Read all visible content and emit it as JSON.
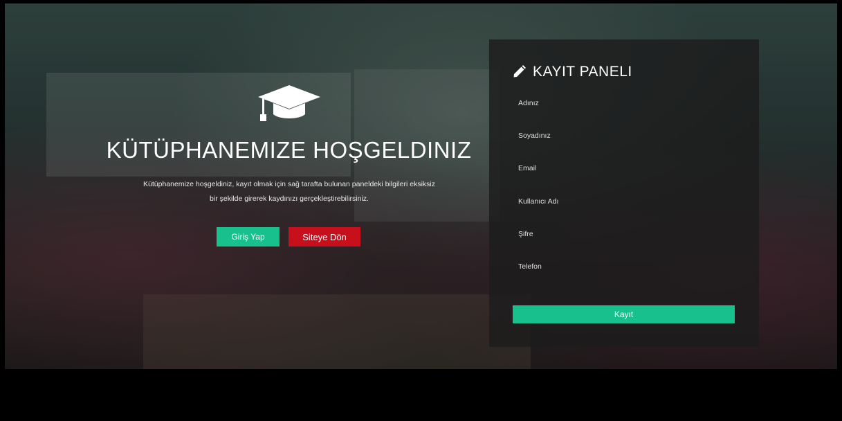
{
  "hero": {
    "title": "KÜTÜPHANEMIZE HOŞGELDINIZ",
    "text_line1": "Kütüphanemize hoşgeldiniz, kayıt olmak için sağ tarafta bulunan paneldeki bilgileri eksiksiz",
    "text_line2": "bir şekilde girerek kaydınızı gerçekleştirebilirsiniz.",
    "login_label": "Giriş Yap",
    "back_label": "Siteye Dön",
    "icon": "graduation-cap-icon"
  },
  "panel": {
    "title": "KAYIT PANELI",
    "icon": "pencil-icon",
    "fields": [
      {
        "label": "Adınız",
        "value": ""
      },
      {
        "label": "Soyadınız",
        "value": ""
      },
      {
        "label": "Email",
        "value": ""
      },
      {
        "label": "Kullanıcı Adı",
        "value": ""
      },
      {
        "label": "Şifre",
        "value": ""
      },
      {
        "label": "Telefon",
        "value": ""
      }
    ],
    "submit_label": "Kayıt"
  },
  "colors": {
    "accent_green": "#17c08c",
    "accent_red": "#c8101c",
    "panel_bg": "#1c1c1c"
  }
}
